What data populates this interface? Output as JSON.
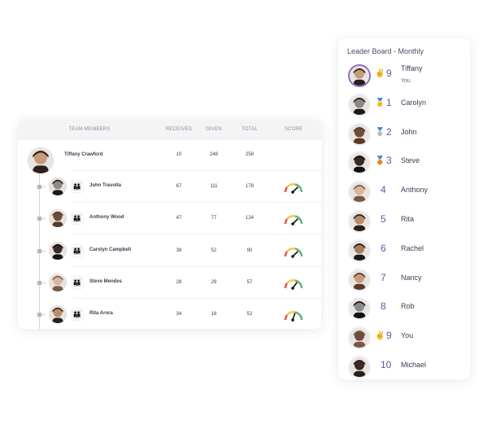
{
  "team_table": {
    "columns": [
      "TEAM MEMBERS",
      "RECEIVED",
      "GIVEN",
      "TOTAL",
      "SCORE"
    ],
    "lead": {
      "name": "Tiffany Crawford",
      "received": "10",
      "given": "248",
      "total": "258"
    },
    "members": [
      {
        "name": "John Travolta",
        "received": "67",
        "given": "111",
        "total": "178",
        "score_level": 0.75,
        "badge_icon": "team-icon"
      },
      {
        "name": "Anthony Wood",
        "received": "47",
        "given": "77",
        "total": "124",
        "score_level": 0.75,
        "badge_icon": "team-icon"
      },
      {
        "name": "Carolyn Campbell",
        "received": "38",
        "given": "52",
        "total": "90",
        "score_level": 0.75,
        "badge_icon": "team-icon"
      },
      {
        "name": "Steve Mendes",
        "received": "28",
        "given": "29",
        "total": "57",
        "score_level": 0.7,
        "badge_icon": "team-icon"
      },
      {
        "name": "Rita Arora",
        "received": "34",
        "given": "18",
        "total": "52",
        "score_level": 0.6,
        "badge_icon": "team-icon"
      }
    ],
    "gauge_colors": {
      "low": "#e0545a",
      "mid": "#f2c94c",
      "high": "#5fb37f"
    }
  },
  "leaderboard": {
    "title": "Leader Board - Monthly",
    "accent": "#6b4fa8",
    "rows": [
      {
        "rank": "9",
        "name": "Tiffany",
        "sub": "You",
        "icon": "victory-hand-icon",
        "me": true
      },
      {
        "rank": "1",
        "name": "Carolyn",
        "icon": "gold-medal-icon"
      },
      {
        "rank": "2",
        "name": "John",
        "icon": "silver-medal-icon"
      },
      {
        "rank": "3",
        "name": "Steve",
        "icon": "bronze-medal-icon"
      },
      {
        "rank": "4",
        "name": "Anthony"
      },
      {
        "rank": "5",
        "name": "Rita"
      },
      {
        "rank": "6",
        "name": "Rachel"
      },
      {
        "rank": "7",
        "name": "Nancy"
      },
      {
        "rank": "8",
        "name": "Rob"
      },
      {
        "rank": "9",
        "name": "You",
        "icon": "victory-hand-icon"
      },
      {
        "rank": "10",
        "name": "Michael"
      }
    ]
  }
}
